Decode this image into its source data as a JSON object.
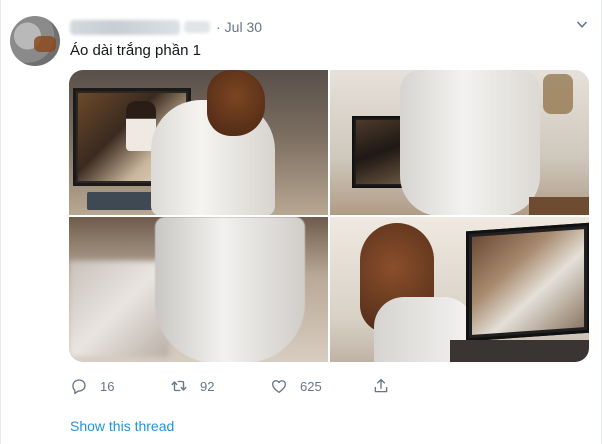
{
  "tweet": {
    "date": "Jul 30",
    "separator": "·",
    "text": "Áo dài trắng phần 1"
  },
  "actions": {
    "replies": "16",
    "retweets": "92",
    "likes": "625"
  },
  "thread_link": "Show this thread",
  "colors": {
    "link": "#1b95e0",
    "muted": "#657786",
    "text": "#14171a"
  },
  "icons": [
    "chevron-down-icon",
    "reply-icon",
    "retweet-icon",
    "like-icon",
    "share-icon"
  ]
}
